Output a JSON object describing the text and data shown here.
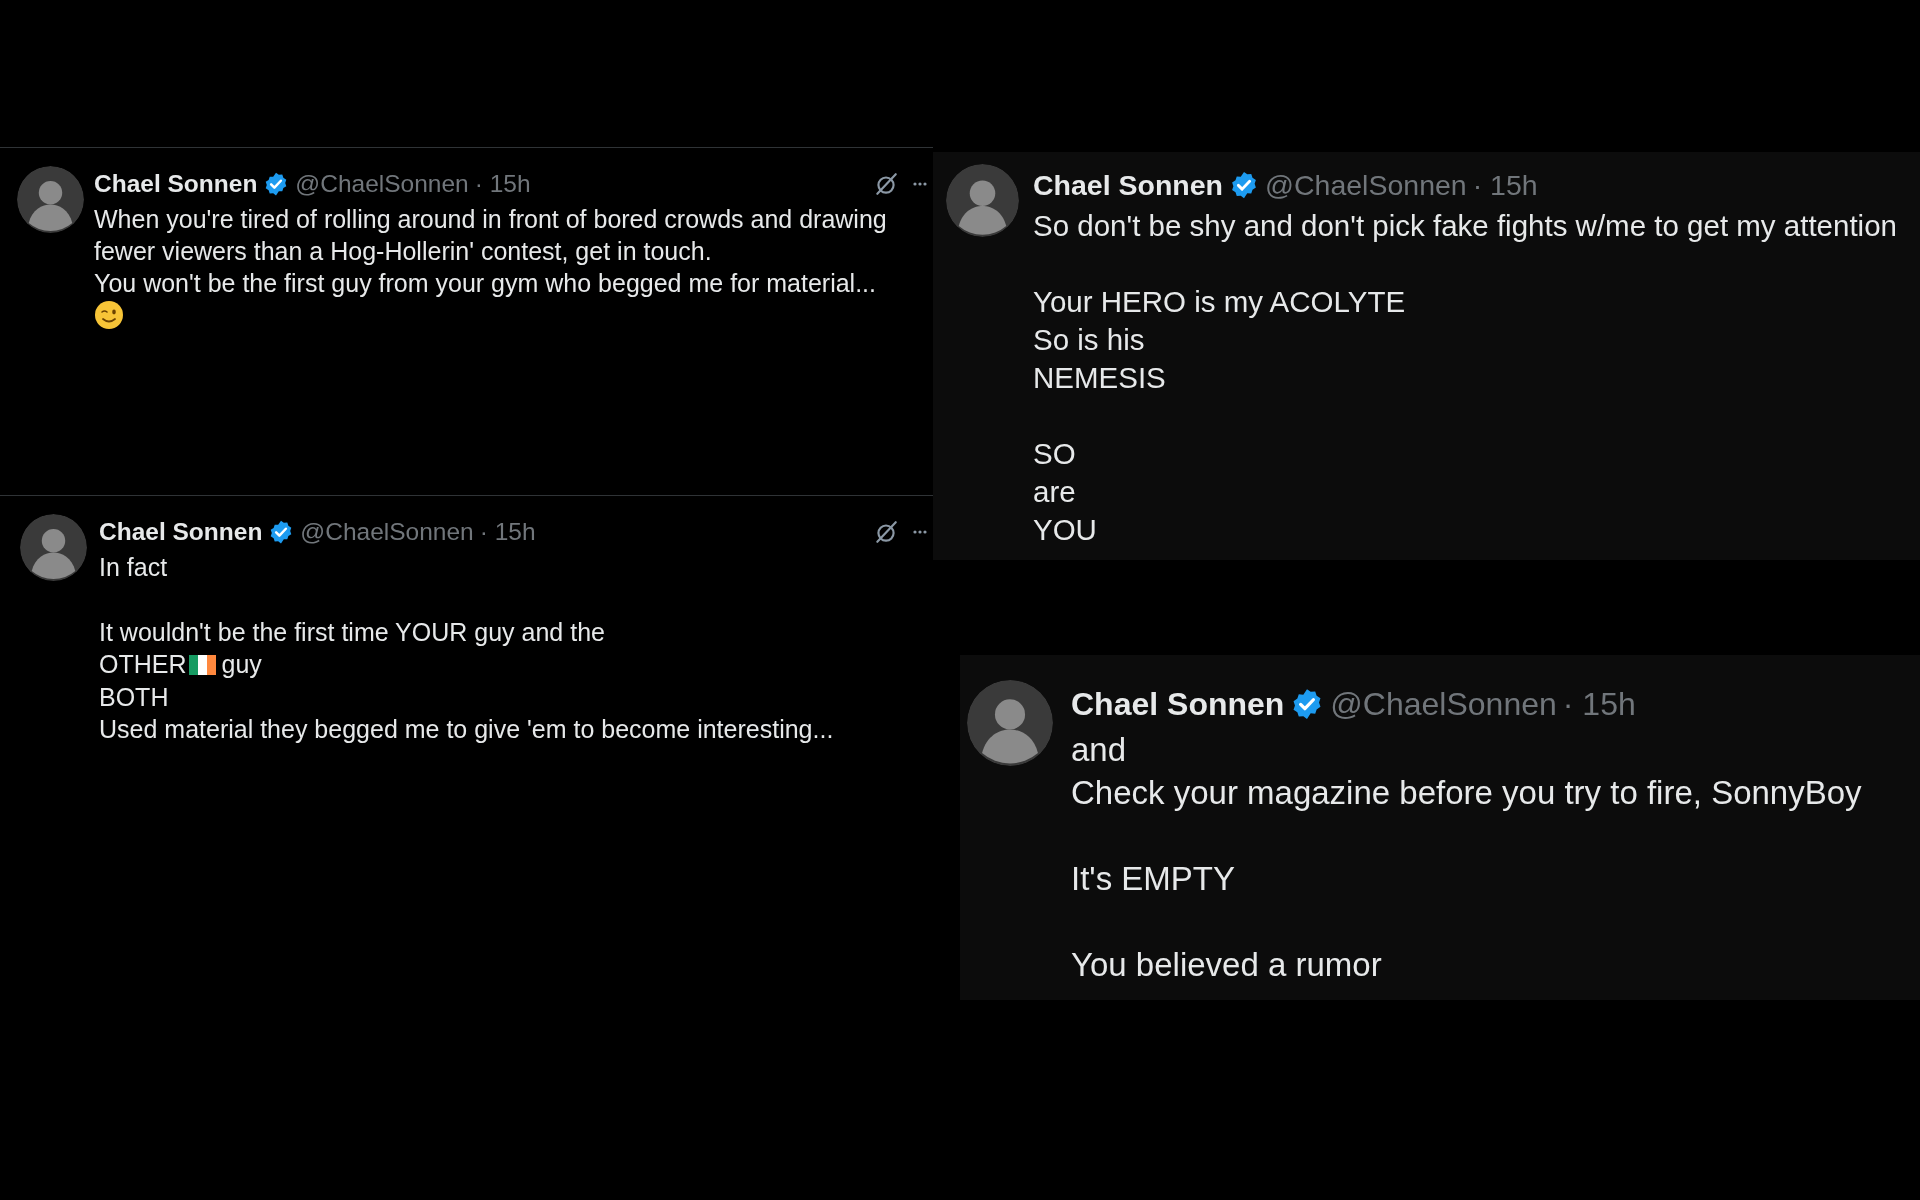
{
  "tweets": [
    {
      "name": "Chael Sonnen",
      "verified": true,
      "handle": "@ChaelSonnen",
      "time": "· 15h",
      "actions": true,
      "lines": [
        {
          "kind": "text",
          "text": "When you're tired of rolling around in front of bored crowds and drawing"
        },
        {
          "kind": "text",
          "text": "fewer viewers than a Hog-Hollerin' contest, get in touch."
        },
        {
          "kind": "text",
          "text": "You won't be the first guy from your gym who begged me for material..."
        },
        {
          "kind": "wink"
        }
      ]
    },
    {
      "name": "Chael Sonnen",
      "verified": true,
      "handle": "@ChaelSonnen",
      "time": "· 15h",
      "actions": true,
      "lines": [
        {
          "kind": "text",
          "text": "In fact"
        },
        {
          "kind": "blank"
        },
        {
          "kind": "text",
          "text": "It wouldn't be the first time YOUR guy and the"
        },
        {
          "kind": "flag",
          "before": "OTHER",
          "after": "guy"
        },
        {
          "kind": "text",
          "text": "BOTH"
        },
        {
          "kind": "text",
          "text": "Used material they begged me to give 'em to become interesting..."
        }
      ]
    },
    {
      "name": "Chael Sonnen",
      "verified": true,
      "handle": "@ChaelSonnen",
      "time": "· 15h",
      "actions": false,
      "lines": [
        {
          "kind": "text",
          "text": "So don't be shy and don't pick fake fights w/me to get my attention"
        },
        {
          "kind": "blank"
        },
        {
          "kind": "text",
          "text": "Your HERO is my ACOLYTE"
        },
        {
          "kind": "text",
          "text": "So is his"
        },
        {
          "kind": "text",
          "text": "NEMESIS"
        },
        {
          "kind": "blank"
        },
        {
          "kind": "text",
          "text": "SO"
        },
        {
          "kind": "text",
          "text": "are"
        },
        {
          "kind": "text",
          "text": "YOU"
        }
      ]
    },
    {
      "name": "Chael Sonnen",
      "verified": true,
      "handle": "@ChaelSonnen",
      "time": "· 15h",
      "actions": false,
      "lines": [
        {
          "kind": "text",
          "text": "and"
        },
        {
          "kind": "text",
          "text": "Check your magazine before you try to fire, SonnyBoy"
        },
        {
          "kind": "blank"
        },
        {
          "kind": "text",
          "text": "It's EMPTY"
        },
        {
          "kind": "blank"
        },
        {
          "kind": "text",
          "text": "You believed a rumor"
        }
      ]
    }
  ]
}
